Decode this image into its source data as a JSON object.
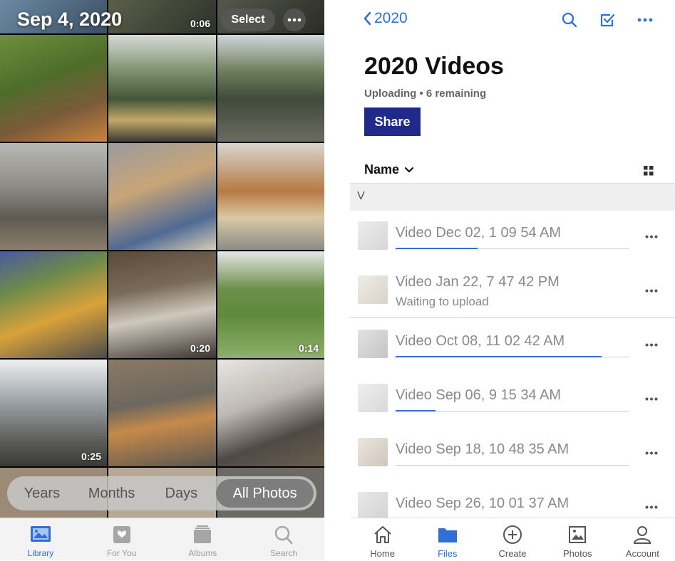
{
  "photos": {
    "date_header": "Sep 4, 2020",
    "select_label": "Select",
    "durations": [
      "0:06",
      "0:20",
      "0:14",
      "0:25"
    ],
    "segments": [
      "Years",
      "Months",
      "Days",
      "All Photos"
    ],
    "tabs": [
      "Library",
      "For You",
      "Albums",
      "Search"
    ],
    "active_tab": "Library"
  },
  "dropbox": {
    "back_label": "2020",
    "title": "2020 Videos",
    "status": "Uploading • 6 remaining",
    "share_label": "Share",
    "sort_label": "Name",
    "section_letter": "V",
    "files": [
      {
        "name": "Video Dec 02, 1 09 54 AM",
        "sub": "",
        "progress": 0.35
      },
      {
        "name": "Video Jan 22, 7 47 42 PM",
        "sub": "Waiting to upload",
        "progress": null
      },
      {
        "name": "Video Oct 08, 11 02 42 AM",
        "sub": "",
        "progress": 0.88
      },
      {
        "name": "Video Sep 06, 9 15 34 AM",
        "sub": "",
        "progress": 0.17
      },
      {
        "name": "Video Sep 18, 10 48 35 AM",
        "sub": "",
        "progress": null
      },
      {
        "name": "Video Sep 26, 10 01 37 AM",
        "sub": "",
        "progress": null
      }
    ],
    "tabs": [
      "Home",
      "Files",
      "Create",
      "Photos",
      "Account"
    ],
    "active_tab": "Files",
    "accent_color": "#2f6fd6",
    "share_color": "#1f2a8c"
  }
}
